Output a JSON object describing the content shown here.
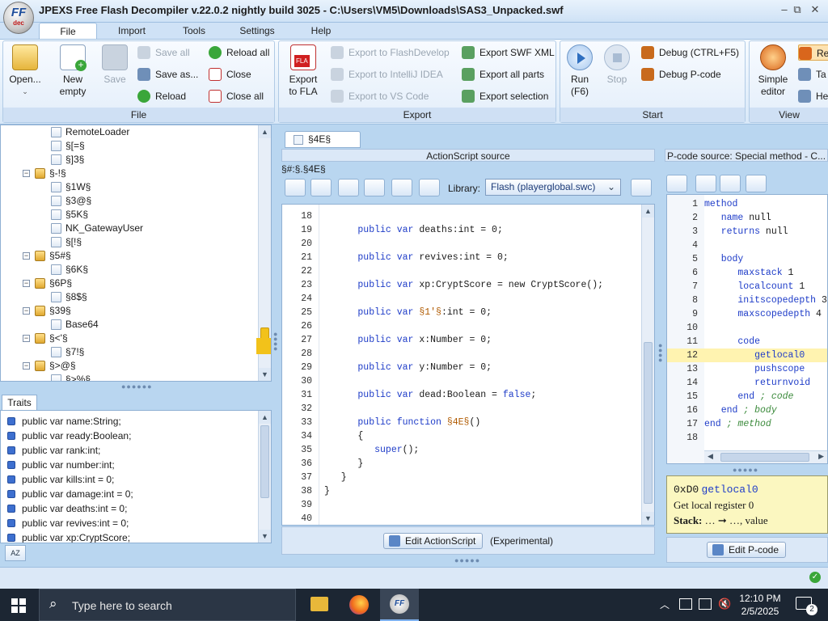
{
  "window": {
    "title": "JPEXS Free Flash Decompiler v.22.0.2 nightly build 3025 - C:\\Users\\VM5\\Downloads\\SAS3_Unpacked.swf",
    "logo_text": "FF",
    "logo_sub": "dec",
    "controls": {
      "minimize": "–",
      "restore": "⧉",
      "close": "✕"
    }
  },
  "ribbon_tabs": [
    "File",
    "Import",
    "Tools",
    "Settings",
    "Help"
  ],
  "ribbon": {
    "file_group": {
      "label": "File",
      "open": "Open...",
      "new_empty_1": "New",
      "new_empty_2": "empty",
      "save": "Save",
      "save_all": "Save all",
      "save_as": "Save as...",
      "reload": "Reload",
      "reload_all": "Reload all",
      "close": "Close",
      "close_all": "Close all"
    },
    "export_group": {
      "label": "Export",
      "export_fla_1": "Export",
      "export_fla_2": "to FLA",
      "fla_badge": "FLA",
      "export_flashdevelop": "Export to FlashDevelop",
      "export_intellij": "Export to IntelliJ IDEA",
      "export_vscode": "Export to VS Code",
      "export_swf_xml": "Export SWF XML",
      "export_all_parts": "Export all parts",
      "export_selection": "Export selection"
    },
    "start_group": {
      "label": "Start",
      "run_1": "Run",
      "run_2": "(F6)",
      "stop": "Stop",
      "debug": "Debug (CTRL+F5)",
      "debug_pcode": "Debug P-code"
    },
    "view_group": {
      "label": "View",
      "simple_editor_1": "Simple",
      "simple_editor_2": "editor",
      "cut_1": "Re",
      "cut_2": "Ta",
      "cut_3": "He"
    }
  },
  "tree": {
    "items": [
      {
        "label": "RemoteLoader",
        "type": "file",
        "depth": 2
      },
      {
        "label": "§[=§",
        "type": "file",
        "depth": 2
      },
      {
        "label": "§]3§",
        "type": "file",
        "depth": 2
      },
      {
        "label": "§-!§",
        "type": "package",
        "depth": 1
      },
      {
        "label": "§1W§",
        "type": "file",
        "depth": 2
      },
      {
        "label": "§3@§",
        "type": "file",
        "depth": 2
      },
      {
        "label": "§5K§",
        "type": "file",
        "depth": 2
      },
      {
        "label": "NK_GatewayUser",
        "type": "file",
        "depth": 2
      },
      {
        "label": "§[!§",
        "type": "file",
        "depth": 2
      },
      {
        "label": "§5#§",
        "type": "package",
        "depth": 1
      },
      {
        "label": "§6K§",
        "type": "file",
        "depth": 2
      },
      {
        "label": "§6P§",
        "type": "package",
        "depth": 1
      },
      {
        "label": "§8$§",
        "type": "file",
        "depth": 2
      },
      {
        "label": "§39§",
        "type": "package",
        "depth": 1
      },
      {
        "label": "Base64",
        "type": "file",
        "depth": 2
      },
      {
        "label": "§<'§",
        "type": "package",
        "depth": 1
      },
      {
        "label": "§7!§",
        "type": "file",
        "depth": 2
      },
      {
        "label": "§>@§",
        "type": "package",
        "depth": 1
      },
      {
        "label": "§>%§",
        "type": "file",
        "depth": 2
      }
    ]
  },
  "traits": {
    "tab": "Traits",
    "items": [
      "public var name:String;",
      "public var ready:Boolean;",
      "public var rank:int;",
      "public var number:int;",
      "public var kills:int = 0;",
      "public var damage:int = 0;",
      "public var deaths:int = 0;",
      "public var revives:int = 0;",
      "public var xp:CryptScore;"
    ],
    "sort_button": "AZ"
  },
  "editor": {
    "tab": "§4E§",
    "header": "ActionScript source",
    "path": "§#:§.§4E§",
    "library_label": "Library:",
    "library_value": "Flash (playerglobal.swc)",
    "lines": [
      {
        "n": "18",
        "parts": []
      },
      {
        "n": "19",
        "parts": [
          [
            "kw",
            "      public var "
          ],
          [
            "",
            "deaths:int = 0;"
          ]
        ]
      },
      {
        "n": "20",
        "parts": []
      },
      {
        "n": "21",
        "parts": [
          [
            "kw",
            "      public var "
          ],
          [
            "",
            "revives:int = 0;"
          ]
        ]
      },
      {
        "n": "22",
        "parts": []
      },
      {
        "n": "23",
        "parts": [
          [
            "kw",
            "      public var "
          ],
          [
            "",
            "xp:CryptScore = new CryptScore();"
          ]
        ]
      },
      {
        "n": "24",
        "parts": []
      },
      {
        "n": "25",
        "parts": [
          [
            "kw",
            "      public var "
          ],
          [
            "fnm",
            "§1'§"
          ],
          [
            "",
            ":int = 0;"
          ]
        ]
      },
      {
        "n": "26",
        "parts": []
      },
      {
        "n": "27",
        "parts": [
          [
            "kw",
            "      public var "
          ],
          [
            "",
            "x:Number = 0;"
          ]
        ]
      },
      {
        "n": "28",
        "parts": []
      },
      {
        "n": "29",
        "parts": [
          [
            "kw",
            "      public var "
          ],
          [
            "",
            "y:Number = 0;"
          ]
        ]
      },
      {
        "n": "30",
        "parts": []
      },
      {
        "n": "31",
        "parts": [
          [
            "kw",
            "      public var "
          ],
          [
            "",
            "dead:Boolean = "
          ],
          [
            "kw",
            "false"
          ],
          [
            "",
            ";"
          ]
        ]
      },
      {
        "n": "32",
        "parts": []
      },
      {
        "n": "33",
        "parts": [
          [
            "kw",
            "      public function "
          ],
          [
            "fnm",
            "§4E§"
          ],
          [
            "",
            "()"
          ]
        ]
      },
      {
        "n": "34",
        "parts": [
          [
            "",
            "      {"
          ]
        ]
      },
      {
        "n": "35",
        "parts": [
          [
            "kw",
            "         super"
          ],
          [
            "",
            "();"
          ]
        ]
      },
      {
        "n": "36",
        "parts": [
          [
            "",
            "      }"
          ]
        ]
      },
      {
        "n": "37",
        "parts": [
          [
            "",
            "   }"
          ]
        ]
      },
      {
        "n": "38",
        "parts": [
          [
            "",
            "}"
          ]
        ]
      },
      {
        "n": "39",
        "parts": []
      },
      {
        "n": "40",
        "parts": []
      }
    ],
    "edit_button": "Edit ActionScript",
    "experimental": "(Experimental)"
  },
  "pcode": {
    "header": "P-code source: Special method - C...",
    "lines": [
      {
        "n": "1",
        "parts": [
          [
            "pk",
            "method"
          ]
        ]
      },
      {
        "n": "2",
        "parts": [
          [
            "pk",
            "   name "
          ],
          [
            "",
            "null"
          ]
        ]
      },
      {
        "n": "3",
        "parts": [
          [
            "pk",
            "   returns "
          ],
          [
            "",
            "null"
          ]
        ]
      },
      {
        "n": "4",
        "parts": []
      },
      {
        "n": "5",
        "parts": [
          [
            "pk",
            "   body"
          ]
        ]
      },
      {
        "n": "6",
        "parts": [
          [
            "pk",
            "      maxstack "
          ],
          [
            "",
            "1"
          ]
        ]
      },
      {
        "n": "7",
        "parts": [
          [
            "pk",
            "      localcount "
          ],
          [
            "",
            "1"
          ]
        ]
      },
      {
        "n": "8",
        "parts": [
          [
            "pk",
            "      initscopedepth "
          ],
          [
            "",
            "3"
          ]
        ]
      },
      {
        "n": "9",
        "parts": [
          [
            "pk",
            "      maxscopedepth "
          ],
          [
            "",
            "4"
          ]
        ]
      },
      {
        "n": "10",
        "parts": []
      },
      {
        "n": "11",
        "parts": [
          [
            "pk",
            "      code"
          ]
        ]
      },
      {
        "n": "12",
        "parts": [
          [
            "pk",
            "         getlocal0"
          ]
        ]
      },
      {
        "n": "13",
        "parts": [
          [
            "pk",
            "         pushscope"
          ]
        ]
      },
      {
        "n": "14",
        "parts": [
          [
            "pk",
            "         returnvoid"
          ]
        ]
      },
      {
        "n": "15",
        "parts": [
          [
            "pk",
            "      end "
          ],
          [
            "cm",
            "; code"
          ]
        ]
      },
      {
        "n": "16",
        "parts": [
          [
            "pk",
            "   end "
          ],
          [
            "cm",
            "; body"
          ]
        ]
      },
      {
        "n": "17",
        "parts": [
          [
            "pk",
            "end "
          ],
          [
            "cm",
            "; method"
          ]
        ]
      },
      {
        "n": "18",
        "parts": []
      }
    ],
    "highlight_line": "12",
    "tooltip_opcode_hex": "0xD0",
    "tooltip_opcode": "getlocal0",
    "tooltip_desc": "Get local register 0",
    "tooltip_stack_label": "Stack:",
    "tooltip_stack": "… ➞ …, value",
    "edit_button": "Edit P-code"
  },
  "taskbar": {
    "search_placeholder": "Type here to search",
    "time": "12:10 PM",
    "date": "2/5/2025",
    "notification_count": "2"
  },
  "colors": {
    "accent": "#3d6fcf",
    "keyword": "#1e3cc8",
    "identifier": "#b05a00",
    "comment": "#3b8a3b",
    "highlight_line": "#fff3b0",
    "tooltip_bg": "#fbf7c0"
  }
}
